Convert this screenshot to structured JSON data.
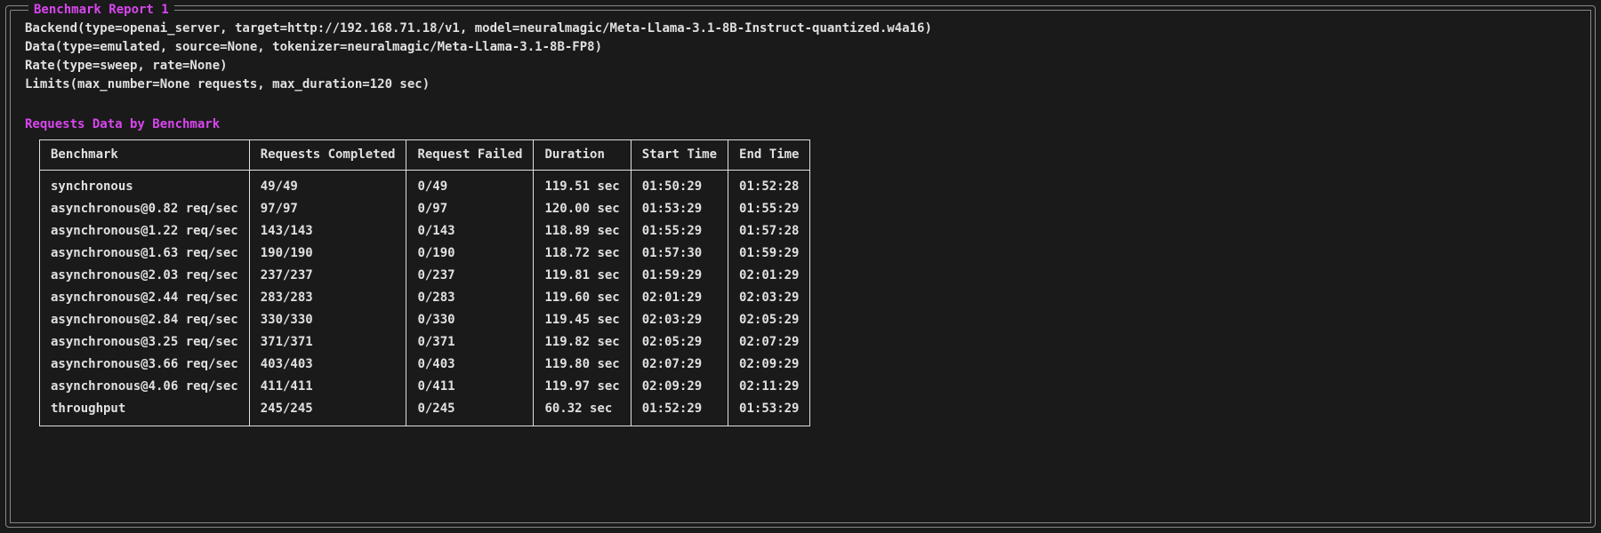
{
  "panel": {
    "title": "Benchmark Report 1",
    "config_lines": [
      "Backend(type=openai_server, target=http://192.168.71.18/v1, model=neuralmagic/Meta-Llama-3.1-8B-Instruct-quantized.w4a16)",
      "Data(type=emulated, source=None, tokenizer=neuralmagic/Meta-Llama-3.1-8B-FP8)",
      "Rate(type=sweep, rate=None)",
      "Limits(max_number=None requests, max_duration=120 sec)"
    ],
    "section_title": "Requests Data by Benchmark",
    "table": {
      "headers": [
        "Benchmark",
        "Requests Completed",
        "Request Failed",
        "Duration",
        "Start Time",
        "End Time"
      ],
      "rows": [
        {
          "benchmark": "synchronous",
          "completed": "49/49",
          "failed": "0/49",
          "duration": "119.51 sec",
          "start": "01:50:29",
          "end": "01:52:28"
        },
        {
          "benchmark": "asynchronous@0.82 req/sec",
          "completed": "97/97",
          "failed": "0/97",
          "duration": "120.00 sec",
          "start": "01:53:29",
          "end": "01:55:29"
        },
        {
          "benchmark": "asynchronous@1.22 req/sec",
          "completed": "143/143",
          "failed": "0/143",
          "duration": "118.89 sec",
          "start": "01:55:29",
          "end": "01:57:28"
        },
        {
          "benchmark": "asynchronous@1.63 req/sec",
          "completed": "190/190",
          "failed": "0/190",
          "duration": "118.72 sec",
          "start": "01:57:30",
          "end": "01:59:29"
        },
        {
          "benchmark": "asynchronous@2.03 req/sec",
          "completed": "237/237",
          "failed": "0/237",
          "duration": "119.81 sec",
          "start": "01:59:29",
          "end": "02:01:29"
        },
        {
          "benchmark": "asynchronous@2.44 req/sec",
          "completed": "283/283",
          "failed": "0/283",
          "duration": "119.60 sec",
          "start": "02:01:29",
          "end": "02:03:29"
        },
        {
          "benchmark": "asynchronous@2.84 req/sec",
          "completed": "330/330",
          "failed": "0/330",
          "duration": "119.45 sec",
          "start": "02:03:29",
          "end": "02:05:29"
        },
        {
          "benchmark": "asynchronous@3.25 req/sec",
          "completed": "371/371",
          "failed": "0/371",
          "duration": "119.82 sec",
          "start": "02:05:29",
          "end": "02:07:29"
        },
        {
          "benchmark": "asynchronous@3.66 req/sec",
          "completed": "403/403",
          "failed": "0/403",
          "duration": "119.80 sec",
          "start": "02:07:29",
          "end": "02:09:29"
        },
        {
          "benchmark": "asynchronous@4.06 req/sec",
          "completed": "411/411",
          "failed": "0/411",
          "duration": "119.97 sec",
          "start": "02:09:29",
          "end": "02:11:29"
        },
        {
          "benchmark": "throughput",
          "completed": "245/245",
          "failed": "0/245",
          "duration": "60.32 sec",
          "start": "01:52:29",
          "end": "01:53:29"
        }
      ]
    }
  }
}
